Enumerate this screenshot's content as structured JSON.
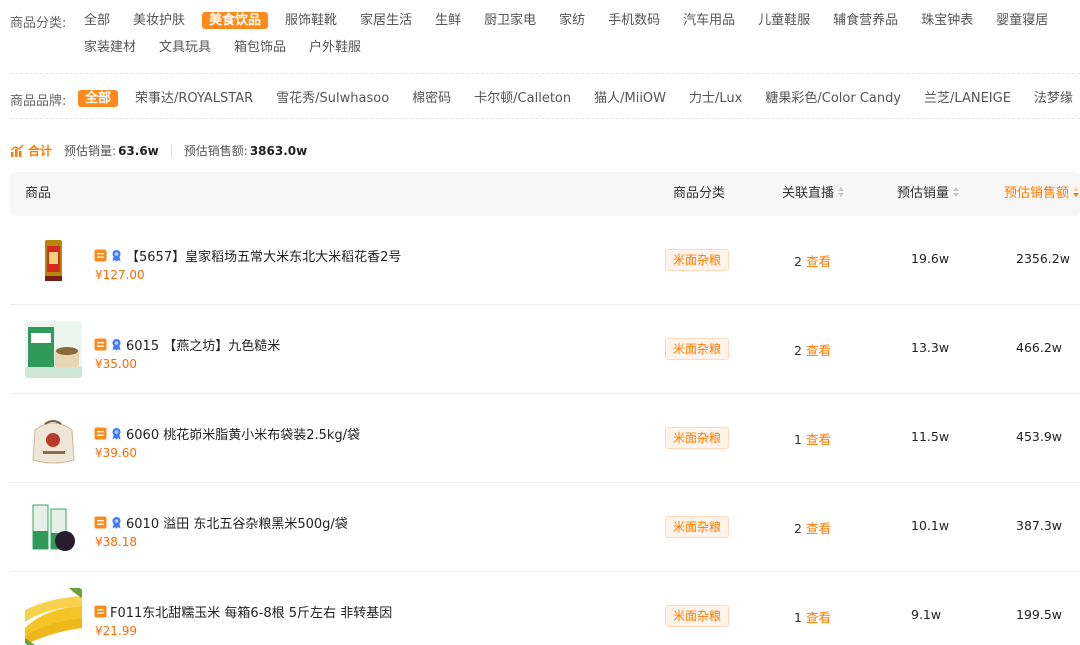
{
  "category_filter": {
    "label": "商品分类:",
    "items": [
      "全部",
      "美妆护肤",
      "美食饮品",
      "服饰鞋靴",
      "家居生活",
      "生鲜",
      "厨卫家电",
      "家纺",
      "手机数码",
      "汽车用品",
      "儿童鞋服",
      "辅食营养品",
      "珠宝钟表",
      "婴童寝居",
      "家装建材",
      "文具玩具",
      "箱包饰品",
      "户外鞋服"
    ],
    "active_index": 2
  },
  "brand_filter": {
    "label": "商品品牌:",
    "items": [
      "全部",
      "荣事达/ROYALSTAR",
      "雪花秀/Sulwhasoo",
      "棉密码",
      "卡尔顿/Calleton",
      "猫人/MiiOW",
      "力士/Lux",
      "糖果彩色/Color Candy",
      "兰芝/LANEIGE",
      "法梦缘"
    ],
    "active_index": 0
  },
  "summary": {
    "label": "合计",
    "est_volume_label": "预估销量:",
    "est_volume_value": "63.6w",
    "est_sales_label": "预估销售额:",
    "est_sales_value": "3863.0w"
  },
  "table": {
    "headers": {
      "product": "商品",
      "category": "商品分类",
      "live": "关联直播",
      "volume": "预估销量",
      "sales": "预估销售额"
    },
    "view_label": "查看",
    "rows": [
      {
        "title": "【5657】皇家稻场五常大米东北大米稻花香2号",
        "price": "¥127.00",
        "category": "米面杂粮",
        "live_count": "2",
        "volume": "19.6w",
        "sales": "2356.2w",
        "has_ribbon": true,
        "thumb": "rice-bag"
      },
      {
        "title": "6015 【燕之坊】九色糙米",
        "price": "¥35.00",
        "category": "米面杂粮",
        "live_count": "2",
        "volume": "13.3w",
        "sales": "466.2w",
        "has_ribbon": true,
        "thumb": "green-box"
      },
      {
        "title": "6060 桃花峁米脂黄小米布袋装2.5kg/袋",
        "price": "¥39.60",
        "category": "米面杂粮",
        "live_count": "1",
        "volume": "11.5w",
        "sales": "453.9w",
        "has_ribbon": true,
        "thumb": "cloth-bag"
      },
      {
        "title": "6010 溢田 东北五谷杂粮黑米500g/袋",
        "price": "¥38.18",
        "category": "米面杂粮",
        "live_count": "2",
        "volume": "10.1w",
        "sales": "387.3w",
        "has_ribbon": true,
        "thumb": "black-rice"
      },
      {
        "title": "F011东北甜糯玉米 每箱6-8根 5斤左右 非转基因",
        "price": "¥21.99",
        "category": "米面杂粮",
        "live_count": "1",
        "volume": "9.1w",
        "sales": "199.5w",
        "has_ribbon": false,
        "thumb": "corn"
      }
    ]
  },
  "colors": {
    "accent": "#ff7a00",
    "active_tag_bg": "#ff8a1c",
    "price": "#ff6a00",
    "ribbon": "#3a7bff"
  }
}
